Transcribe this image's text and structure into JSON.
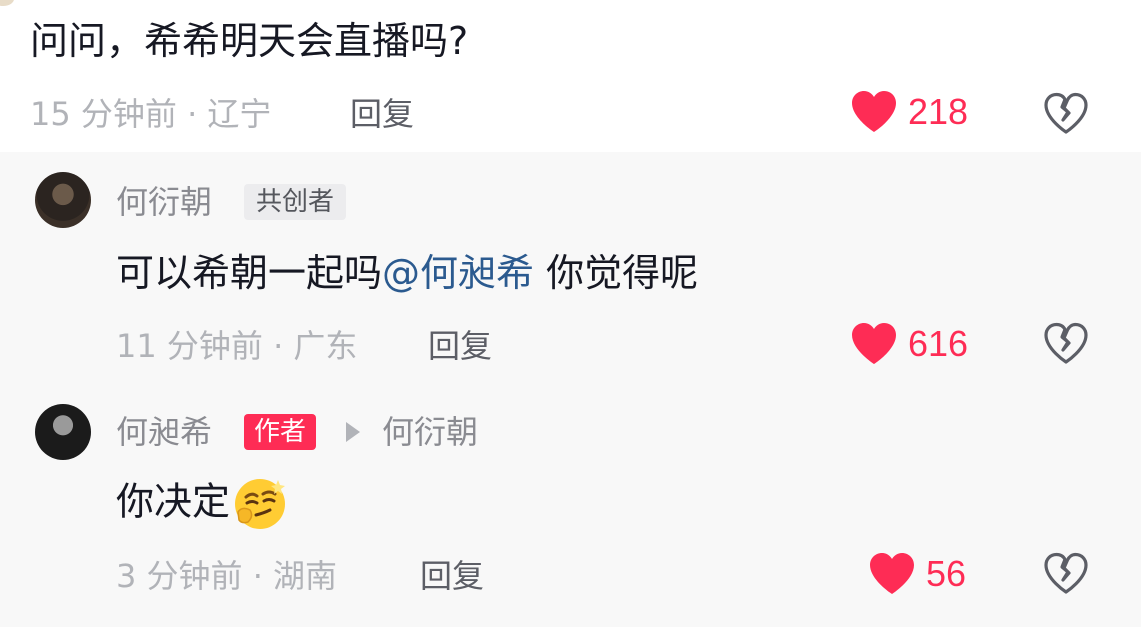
{
  "top_comment": {
    "text": "问问，希希明天会直播吗?",
    "meta": "15 分钟前 · 辽宁",
    "reply_label": "回复",
    "likes": "218"
  },
  "replies": [
    {
      "username": "何衍朝",
      "badge": "共创者",
      "text_main": "可以希朝一起吗",
      "mention": "@何昶希",
      "text_tail": " 你觉得呢",
      "meta": "11 分钟前 · 广东",
      "reply_label": "回复",
      "likes": "616"
    },
    {
      "username": "何昶希",
      "badge": "作者",
      "reply_to": "何衍朝",
      "text": "你决定",
      "emoji": "thinking-smirk-emoji",
      "meta": "3 分钟前 · 湖南",
      "reply_label": "回复",
      "likes": "56"
    }
  ],
  "colors": {
    "like": "#fe2c55",
    "mention": "#2b5a8f",
    "author_badge": "#fe2c55",
    "background": "#f8f8f8"
  }
}
